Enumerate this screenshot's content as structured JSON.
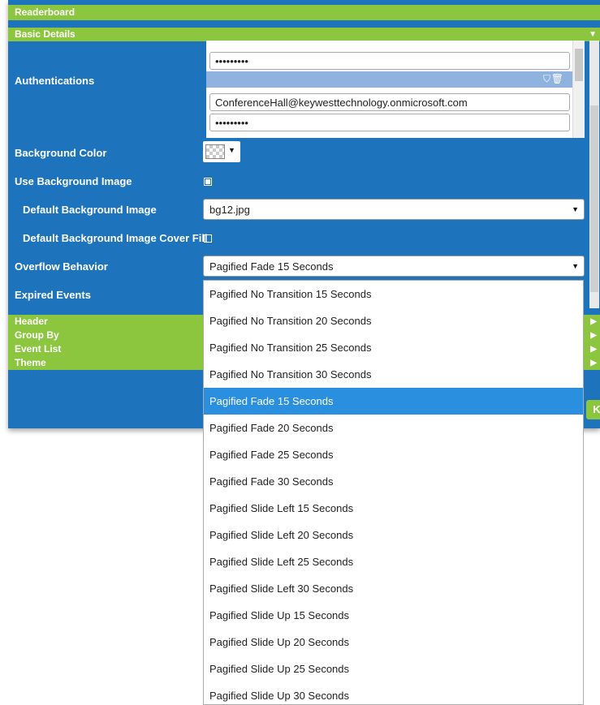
{
  "header": {
    "title": "Readerboard"
  },
  "sections": {
    "basic_details": "Basic Details",
    "header": "Header",
    "group_by": "Group By",
    "event_list": "Event List",
    "theme": "Theme"
  },
  "fields": {
    "authentications_label": "Authentications",
    "auth1_password": "•••••••••",
    "auth2_email": "ConferenceHall@keywesttechnology.onmicrosoft.com",
    "auth2_password": "•••••••••",
    "background_color_label": "Background Color",
    "use_background_image_label": "Use Background Image",
    "use_background_image_checked": true,
    "default_background_image_label": "Default Background Image",
    "default_background_image_value": "bg12.jpg",
    "cover_fill_label": "Default Background Image Cover Fill",
    "cover_fill_checked": false,
    "overflow_behavior_label": "Overflow Behavior",
    "overflow_behavior_value": "Pagified Fade 15 Seconds",
    "expired_events_label": "Expired Events"
  },
  "dropdown": {
    "selected": "Pagified Fade 15 Seconds",
    "options": [
      "Pagified No Transition 15 Seconds",
      "Pagified No Transition 20 Seconds",
      "Pagified No Transition 25 Seconds",
      "Pagified No Transition 30 Seconds",
      "Pagified Fade 15 Seconds",
      "Pagified Fade 20 Seconds",
      "Pagified Fade 25 Seconds",
      "Pagified Fade 30 Seconds",
      "Pagified Slide Left 15 Seconds",
      "Pagified Slide Left 20 Seconds",
      "Pagified Slide Left 25 Seconds",
      "Pagified Slide Left 30 Seconds",
      "Pagified Slide Up 15 Seconds",
      "Pagified Slide Up 20 Seconds",
      "Pagified Slide Up 25 Seconds",
      "Pagified Slide Up 30 Seconds"
    ]
  },
  "ok_button_visible": "K",
  "colors": {
    "green": "#8cc63f",
    "blue": "#1e74bc",
    "selected": "#2b8fe0"
  }
}
